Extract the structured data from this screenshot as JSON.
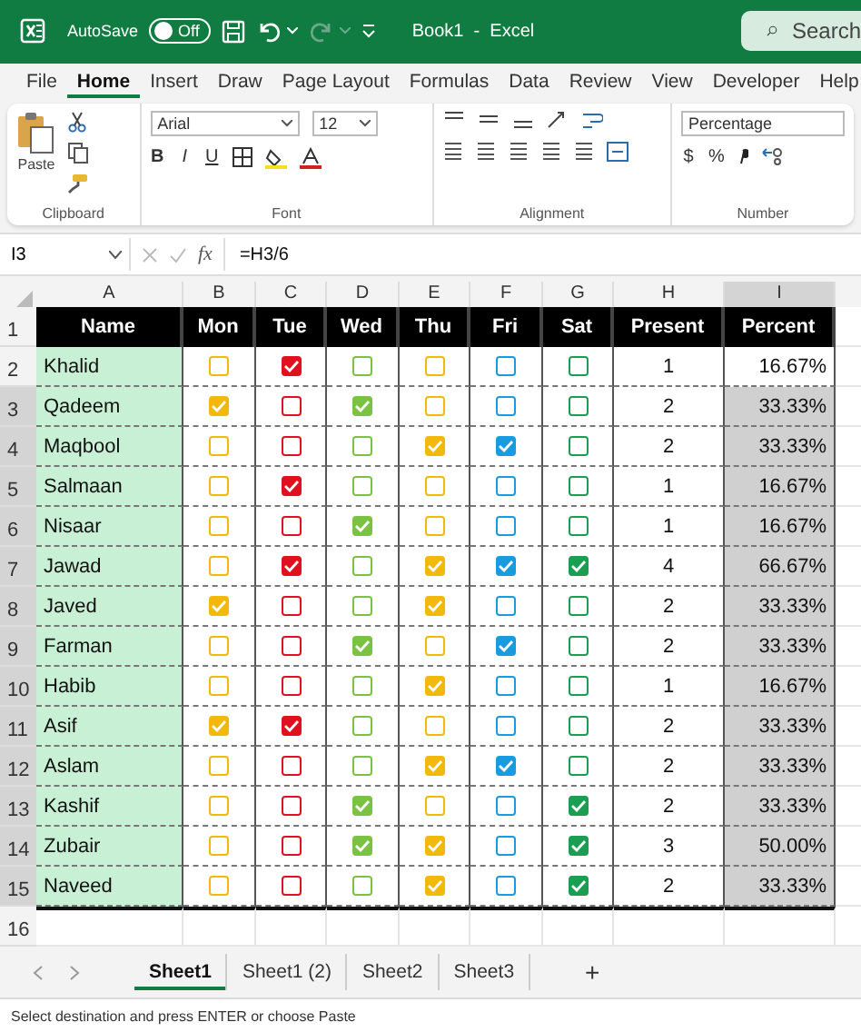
{
  "title_bar": {
    "autosave_label": "AutoSave",
    "autosave": {
      "label": "Off",
      "on": false
    },
    "document_title": "Book1  -  Excel",
    "search": {
      "placeholder": "Search"
    }
  },
  "menu_tabs": [
    {
      "label": "File",
      "selected": false
    },
    {
      "label": "Home",
      "selected": true
    },
    {
      "label": "Insert",
      "selected": false
    },
    {
      "label": "Draw",
      "selected": false
    },
    {
      "label": "Page Layout",
      "selected": false
    },
    {
      "label": "Formulas",
      "selected": false
    },
    {
      "label": "Data",
      "selected": false
    },
    {
      "label": "Review",
      "selected": false
    },
    {
      "label": "View",
      "selected": false
    },
    {
      "label": "Developer",
      "selected": false
    },
    {
      "label": "Help",
      "selected": false
    }
  ],
  "ribbon": {
    "clipboard": {
      "paste_label": "Paste",
      "group_label": "Clipboard"
    },
    "font": {
      "family": "Arial",
      "size": "12",
      "bold": "B",
      "italic": "I",
      "underline": "U",
      "group_label": "Font"
    },
    "alignment": {
      "group_label": "Alignment"
    },
    "number": {
      "format": "Percentage",
      "currency": "$",
      "percent": "%",
      "group_label": "Number"
    }
  },
  "formula_bar": {
    "name_box": "I3",
    "fx": "fx",
    "formula": "=H3/6"
  },
  "columns": [
    {
      "letter": "A",
      "selected": false
    },
    {
      "letter": "B",
      "selected": false
    },
    {
      "letter": "C",
      "selected": false
    },
    {
      "letter": "D",
      "selected": false
    },
    {
      "letter": "E",
      "selected": false
    },
    {
      "letter": "F",
      "selected": false
    },
    {
      "letter": "G",
      "selected": false
    },
    {
      "letter": "H",
      "selected": false
    },
    {
      "letter": "I",
      "selected": true
    }
  ],
  "header": {
    "row_number": "1",
    "name": "Name",
    "days": [
      {
        "label": "Mon",
        "color": "#f2b90c"
      },
      {
        "label": "Tue",
        "color": "#e0101e"
      },
      {
        "label": "Wed",
        "color": "#7cc242"
      },
      {
        "label": "Thu",
        "color": "#f2b90c"
      },
      {
        "label": "Fri",
        "color": "#1a9be0"
      },
      {
        "label": "Sat",
        "color": "#1b9e52"
      }
    ],
    "present": "Present",
    "percent": "Percent"
  },
  "rows": [
    {
      "row_number": "2",
      "name": "Khalid",
      "days": [
        {
          "checked": false
        },
        {
          "checked": true
        },
        {
          "checked": false
        },
        {
          "checked": false
        },
        {
          "checked": false
        },
        {
          "checked": false
        }
      ],
      "present": "1",
      "percent": "16.67%",
      "selected": false
    },
    {
      "row_number": "3",
      "name": "Qadeem",
      "days": [
        {
          "checked": true
        },
        {
          "checked": false
        },
        {
          "checked": true
        },
        {
          "checked": false
        },
        {
          "checked": false
        },
        {
          "checked": false
        }
      ],
      "present": "2",
      "percent": "33.33%",
      "selected": true
    },
    {
      "row_number": "4",
      "name": "Maqbool",
      "days": [
        {
          "checked": false
        },
        {
          "checked": false
        },
        {
          "checked": false
        },
        {
          "checked": true
        },
        {
          "checked": true
        },
        {
          "checked": false
        }
      ],
      "present": "2",
      "percent": "33.33%",
      "selected": true
    },
    {
      "row_number": "5",
      "name": "Salmaan",
      "days": [
        {
          "checked": false
        },
        {
          "checked": true
        },
        {
          "checked": false
        },
        {
          "checked": false
        },
        {
          "checked": false
        },
        {
          "checked": false
        }
      ],
      "present": "1",
      "percent": "16.67%",
      "selected": true
    },
    {
      "row_number": "6",
      "name": "Nisaar",
      "days": [
        {
          "checked": false
        },
        {
          "checked": false
        },
        {
          "checked": true
        },
        {
          "checked": false
        },
        {
          "checked": false
        },
        {
          "checked": false
        }
      ],
      "present": "1",
      "percent": "16.67%",
      "selected": true
    },
    {
      "row_number": "7",
      "name": "Jawad",
      "days": [
        {
          "checked": false
        },
        {
          "checked": true
        },
        {
          "checked": false
        },
        {
          "checked": true
        },
        {
          "checked": true
        },
        {
          "checked": true
        }
      ],
      "present": "4",
      "percent": "66.67%",
      "selected": true
    },
    {
      "row_number": "8",
      "name": "Javed",
      "days": [
        {
          "checked": true
        },
        {
          "checked": false
        },
        {
          "checked": false
        },
        {
          "checked": true
        },
        {
          "checked": false
        },
        {
          "checked": false
        }
      ],
      "present": "2",
      "percent": "33.33%",
      "selected": true
    },
    {
      "row_number": "9",
      "name": "Farman",
      "days": [
        {
          "checked": false
        },
        {
          "checked": false
        },
        {
          "checked": true
        },
        {
          "checked": false
        },
        {
          "checked": true
        },
        {
          "checked": false
        }
      ],
      "present": "2",
      "percent": "33.33%",
      "selected": true
    },
    {
      "row_number": "10",
      "name": "Habib",
      "days": [
        {
          "checked": false
        },
        {
          "checked": false
        },
        {
          "checked": false
        },
        {
          "checked": true
        },
        {
          "checked": false
        },
        {
          "checked": false
        }
      ],
      "present": "1",
      "percent": "16.67%",
      "selected": true
    },
    {
      "row_number": "11",
      "name": "Asif",
      "days": [
        {
          "checked": true
        },
        {
          "checked": true
        },
        {
          "checked": false
        },
        {
          "checked": false
        },
        {
          "checked": false
        },
        {
          "checked": false
        }
      ],
      "present": "2",
      "percent": "33.33%",
      "selected": true
    },
    {
      "row_number": "12",
      "name": "Aslam",
      "days": [
        {
          "checked": false
        },
        {
          "checked": false
        },
        {
          "checked": false
        },
        {
          "checked": true
        },
        {
          "checked": true
        },
        {
          "checked": false
        }
      ],
      "present": "2",
      "percent": "33.33%",
      "selected": true
    },
    {
      "row_number": "13",
      "name": "Kashif",
      "days": [
        {
          "checked": false
        },
        {
          "checked": false
        },
        {
          "checked": true
        },
        {
          "checked": false
        },
        {
          "checked": false
        },
        {
          "checked": true
        }
      ],
      "present": "2",
      "percent": "33.33%",
      "selected": true
    },
    {
      "row_number": "14",
      "name": "Zubair",
      "days": [
        {
          "checked": false
        },
        {
          "checked": false
        },
        {
          "checked": true
        },
        {
          "checked": true
        },
        {
          "checked": false
        },
        {
          "checked": true
        }
      ],
      "present": "3",
      "percent": "50.00%",
      "selected": true
    },
    {
      "row_number": "15",
      "name": "Naveed",
      "days": [
        {
          "checked": false
        },
        {
          "checked": false
        },
        {
          "checked": false
        },
        {
          "checked": true
        },
        {
          "checked": false
        },
        {
          "checked": true
        }
      ],
      "present": "2",
      "percent": "33.33%",
      "selected": true
    }
  ],
  "empty_row": {
    "row_number": "16"
  },
  "sheet_tabs": [
    {
      "label": "Sheet1",
      "selected": true
    },
    {
      "label": "Sheet1 (2)",
      "selected": false
    },
    {
      "label": "Sheet2",
      "selected": false
    },
    {
      "label": "Sheet3",
      "selected": false
    }
  ],
  "add_sheet": "+",
  "status_bar": "Select destination and press ENTER or choose Paste"
}
